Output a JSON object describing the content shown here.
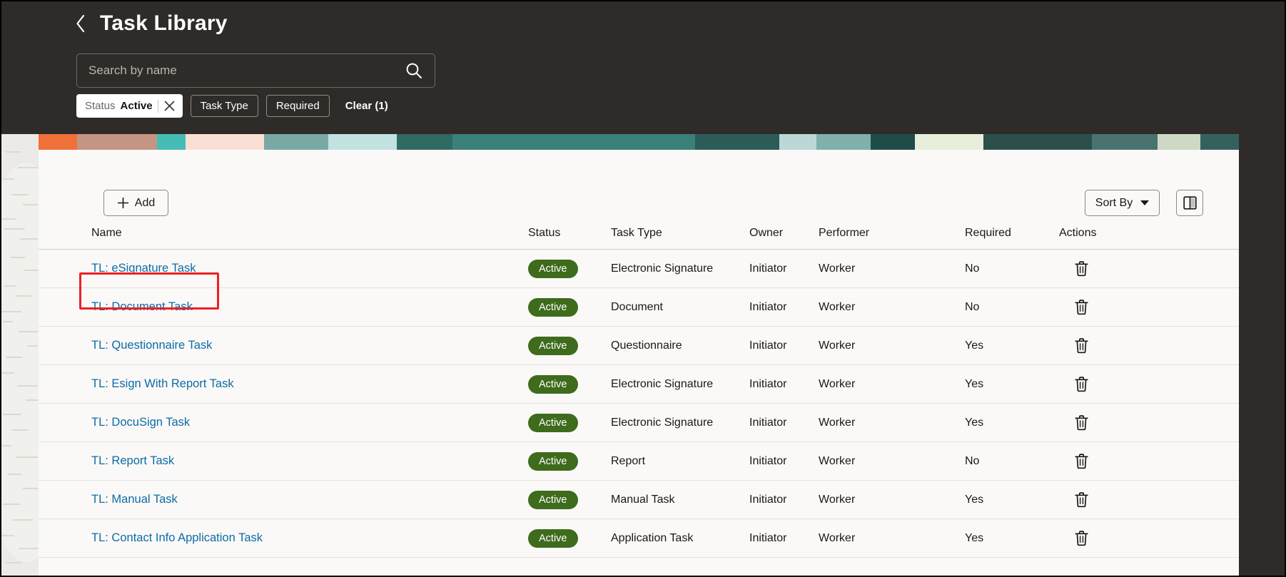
{
  "header": {
    "back_icon": "chevron-left-icon",
    "title": "Task Library",
    "search": {
      "placeholder": "Search by name",
      "value": "",
      "icon": "search-icon"
    },
    "filters": {
      "status_chip": {
        "key": "Status",
        "value": "Active",
        "remove_icon": "close-icon"
      },
      "task_type_label": "Task Type",
      "required_label": "Required",
      "clear_label": "Clear (1)"
    }
  },
  "toolbar": {
    "add_label": "Add",
    "add_icon": "plus-icon",
    "sort_label": "Sort By",
    "sort_caret_icon": "chevron-down-icon",
    "columns_icon": "columns-panel-icon"
  },
  "table": {
    "columns": [
      "Name",
      "Status",
      "Task Type",
      "Owner",
      "Performer",
      "Required",
      "Actions"
    ],
    "rows": [
      {
        "name": "TL: eSignature Task",
        "status": "Active",
        "task_type": "Electronic Signature",
        "owner": "Initiator",
        "performer": "Worker",
        "required": "No",
        "action_icon": "trash-icon",
        "highlighted": true
      },
      {
        "name": "TL: Document Task",
        "status": "Active",
        "task_type": "Document",
        "owner": "Initiator",
        "performer": "Worker",
        "required": "No",
        "action_icon": "trash-icon",
        "highlighted": false
      },
      {
        "name": "TL: Questionnaire Task",
        "status": "Active",
        "task_type": "Questionnaire",
        "owner": "Initiator",
        "performer": "Worker",
        "required": "Yes",
        "action_icon": "trash-icon",
        "highlighted": false
      },
      {
        "name": "TL: Esign With Report Task",
        "status": "Active",
        "task_type": "Electronic Signature",
        "owner": "Initiator",
        "performer": "Worker",
        "required": "Yes",
        "action_icon": "trash-icon",
        "highlighted": false
      },
      {
        "name": "TL: DocuSign Task",
        "status": "Active",
        "task_type": "Electronic Signature",
        "owner": "Initiator",
        "performer": "Worker",
        "required": "Yes",
        "action_icon": "trash-icon",
        "highlighted": false
      },
      {
        "name": "TL: Report Task",
        "status": "Active",
        "task_type": "Report",
        "owner": "Initiator",
        "performer": "Worker",
        "required": "No",
        "action_icon": "trash-icon",
        "highlighted": false
      },
      {
        "name": "TL: Manual Task",
        "status": "Active",
        "task_type": "Manual Task",
        "owner": "Initiator",
        "performer": "Worker",
        "required": "Yes",
        "action_icon": "trash-icon",
        "highlighted": false
      },
      {
        "name": "TL: Contact Info Application Task",
        "status": "Active",
        "task_type": "Application Task",
        "owner": "Initiator",
        "performer": "Worker",
        "required": "Yes",
        "action_icon": "trash-icon",
        "highlighted": false
      }
    ]
  },
  "colors": {
    "header_bg": "#2e2b28",
    "card_bg": "#faf9f7",
    "link": "#0d6ba8",
    "badge_active": "#3e6b1c",
    "annotation": "#ed2024"
  }
}
